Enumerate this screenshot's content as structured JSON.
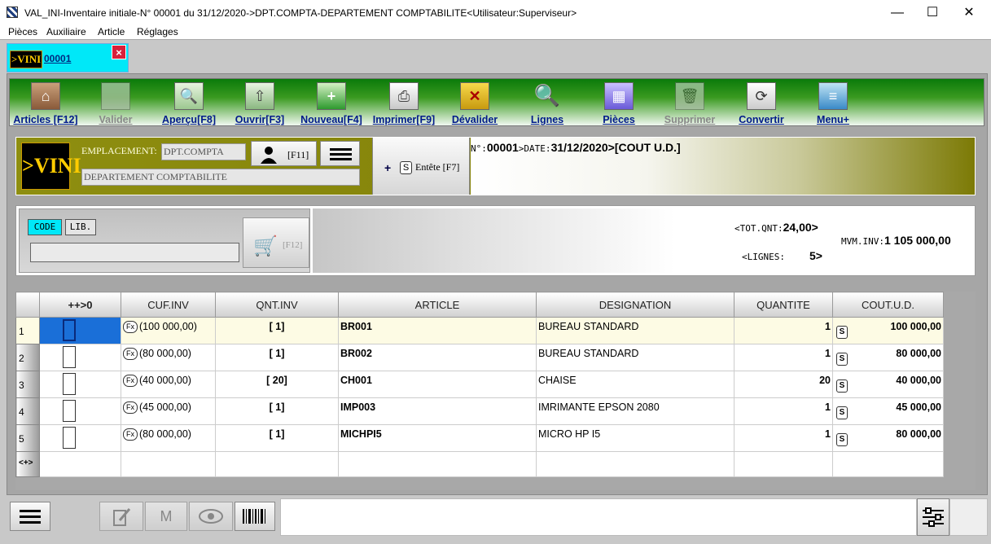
{
  "window": {
    "title": "VAL_INI-Inventaire initiale-N° 00001 du 31/12/2020->DPT.COMPTA-DEPARTEMENT COMPTABILITE<Utilisateur:Superviseur>",
    "minimize": "—",
    "maximize": "☐",
    "close": "✕"
  },
  "menu": [
    "Pièces",
    "Auxiliaire",
    "Article",
    "Réglages"
  ],
  "doc_tab": {
    "logo": ">VINI",
    "number": "00001",
    "close": "×"
  },
  "toolbar": [
    {
      "label": "Articles [F12]",
      "icon": "house-icon",
      "glyph": "⌂",
      "enabled": true
    },
    {
      "label": "Valider",
      "icon": "validate-icon",
      "glyph": "",
      "enabled": false
    },
    {
      "label": "Aperçu[F8]",
      "icon": "preview-icon",
      "glyph": "🔍",
      "enabled": true
    },
    {
      "label": "Ouvrir[F3]",
      "icon": "open-icon",
      "glyph": "⇧",
      "enabled": true
    },
    {
      "label": "Nouveau[F4]",
      "icon": "new-icon",
      "glyph": "+",
      "enabled": true
    },
    {
      "label": "Imprimer[F9]",
      "icon": "print-icon",
      "glyph": "⎙",
      "enabled": true
    },
    {
      "label": "Dévalider",
      "icon": "unvalidate-icon",
      "glyph": "✕",
      "enabled": true
    },
    {
      "label": "Lignes",
      "icon": "search-lines-icon",
      "glyph": "🔍",
      "enabled": true
    },
    {
      "label": "Pièces",
      "icon": "grid-icon",
      "glyph": "▦",
      "enabled": true
    },
    {
      "label": "Supprimer",
      "icon": "delete-icon",
      "glyph": "🗑",
      "enabled": false
    },
    {
      "label": "Convertir",
      "icon": "convert-icon",
      "glyph": "⟳",
      "enabled": true
    },
    {
      "label": "Menu+",
      "icon": "menu-plus-icon",
      "glyph": "≡",
      "enabled": true
    }
  ],
  "header": {
    "logo": ">VINI",
    "emplacement_label": "EMPLACEMENT:",
    "emplacement_value": "DPT.COMPTA",
    "user_key": "[F11]",
    "department": "DEPARTEMENT COMPTABILITE",
    "entete_label": "Entête [F7]",
    "entete_plus": "+",
    "entete_s": "S",
    "no_label": "N°:",
    "number": "00001",
    "date_label": ">DATE:",
    "date": "31/12/2020",
    "cost_method": ">[COUT U.D.]"
  },
  "search": {
    "code_label": "CODE",
    "lib_label": "LIB.",
    "input_value": "",
    "cart_key": "[F12]"
  },
  "totals": {
    "tot_qnt_label": "<TOT.QNT:",
    "tot_qnt": "24,00>",
    "lignes_label": "<LIGNES:",
    "lignes": "5>",
    "mvm_inv_label": "MVM.INV:",
    "mvm_inv": "1 105 000,00"
  },
  "grid": {
    "columns": [
      "++>0",
      "CUF.INV",
      "QNT.INV",
      "ARTICLE",
      "DESIGNATION",
      "QUANTITE",
      "COUT.U.D."
    ],
    "rows": [
      {
        "n": "1",
        "cuf": "(100 000,00)",
        "qnt": "[ 1]",
        "article": "BR001",
        "designation": "BUREAU STANDARD",
        "quantite": "1",
        "cout": "100 000,00"
      },
      {
        "n": "2",
        "cuf": "(80 000,00)",
        "qnt": "[ 1]",
        "article": "BR002",
        "designation": "BUREAU STANDARD",
        "quantite": "1",
        "cout": "80 000,00"
      },
      {
        "n": "3",
        "cuf": "(40 000,00)",
        "qnt": "[ 20]",
        "article": "CH001",
        "designation": "CHAISE",
        "quantite": "20",
        "cout": "40 000,00"
      },
      {
        "n": "4",
        "cuf": "(45 000,00)",
        "qnt": "[ 1]",
        "article": "IMP003",
        "designation": "IMRIMANTE EPSON 2080",
        "quantite": "1",
        "cout": "45 000,00"
      },
      {
        "n": "5",
        "cuf": "(80 000,00)",
        "qnt": "[ 1]",
        "article": "MICHPI5",
        "designation": "MICRO HP I5",
        "quantite": "1",
        "cout": "80 000,00"
      }
    ],
    "new_row_label": "<+>",
    "fx_label": "Fx",
    "s_label": "S"
  },
  "bottom": {
    "m_label": "M"
  }
}
